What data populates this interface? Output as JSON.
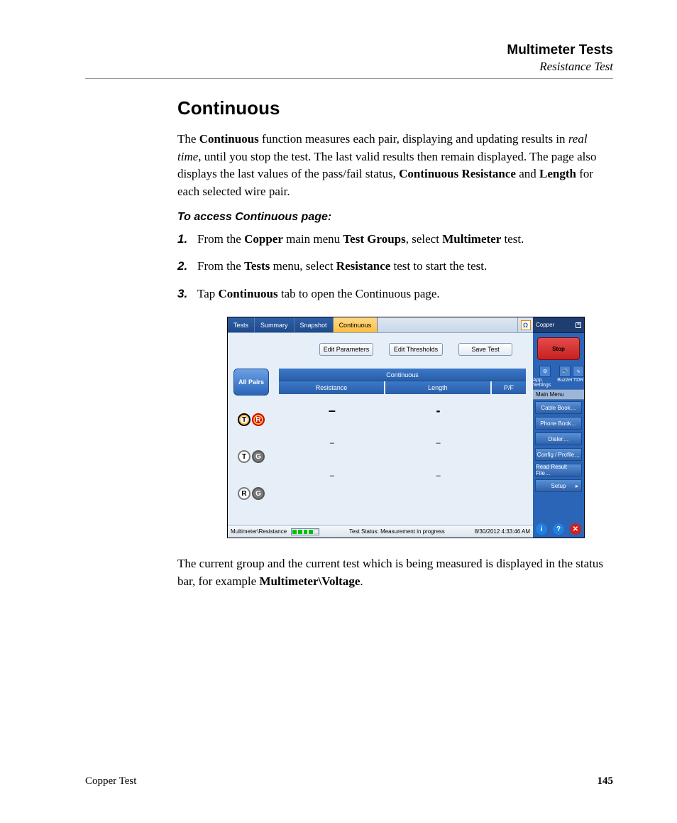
{
  "header": {
    "title": "Multimeter Tests",
    "subtitle": "Resistance Test"
  },
  "section_title": "Continuous",
  "paragraph1_parts": {
    "p1": "The ",
    "b1": "Continuous",
    "p2": " function measures each pair, displaying and updating results in ",
    "i1": "real time",
    "p3": ", until you stop the test. The last valid results then remain displayed. The page also displays the last values of the pass/fail status, ",
    "b2": "Continuous Resistance",
    "p4": " and ",
    "b3": "Length",
    "p5": " for each selected wire pair."
  },
  "subhead": "To access Continuous page:",
  "steps": {
    "n1": "1.",
    "s1": {
      "a": "From the ",
      "b": "Copper",
      "c": " main menu ",
      "d": "Test Groups",
      "e": ", select ",
      "f": "Multimeter",
      "g": " test."
    },
    "n2": "2.",
    "s2": {
      "a": "From the ",
      "b": "Tests",
      "c": " menu, select ",
      "d": "Resistance",
      "e": " test to start the test."
    },
    "n3": "3.",
    "s3": {
      "a": "Tap ",
      "b": "Continuous",
      "c": " tab to open the Continuous page."
    }
  },
  "paragraph2_parts": {
    "p1": "The current group and the current test which is being measured is displayed in the status bar, for example ",
    "b1": "Multimeter\\Voltage",
    "p2": "."
  },
  "screenshot": {
    "tabs": {
      "tests": "Tests",
      "summary": "Summary",
      "snapshot": "Snapshot",
      "continuous": "Continuous"
    },
    "omega": "Ω",
    "buttons": {
      "edit_params": "Edit Parameters",
      "edit_thresh": "Edit Thresholds",
      "save_test": "Save Test"
    },
    "all_pairs": "All Pairs",
    "cont_head": "Continuous",
    "cols": {
      "res": "Resistance",
      "len": "Length",
      "pf": "P/F"
    },
    "rows": [
      {
        "t": "T",
        "r": "R",
        "v1": "–",
        "v2": "-",
        "v3": ""
      },
      {
        "t": "T",
        "g": "G",
        "v1": "–",
        "v2": "–",
        "v3": ""
      },
      {
        "r": "R",
        "g": "G",
        "v1": "–",
        "v2": "–",
        "v3": ""
      }
    ],
    "status": {
      "path": "Multimeter\\Resistance",
      "msg": "Test Status: Measurement in progress",
      "ts": "8/30/2012 4:33:46 AM"
    },
    "side": {
      "title": "Copper",
      "stop": "Stop",
      "icons": {
        "app": "App. Settings",
        "buzz": "Buzzer",
        "tdr": "TDR"
      },
      "menu_hdr": "Main Menu",
      "items": [
        "Cable Book…",
        "Phone Book…",
        "Dialer…",
        "Config / Profile…",
        "Read Result File…",
        "Setup"
      ],
      "arrow": "▸"
    }
  },
  "footer": {
    "left": "Copper Test",
    "page": "145"
  }
}
